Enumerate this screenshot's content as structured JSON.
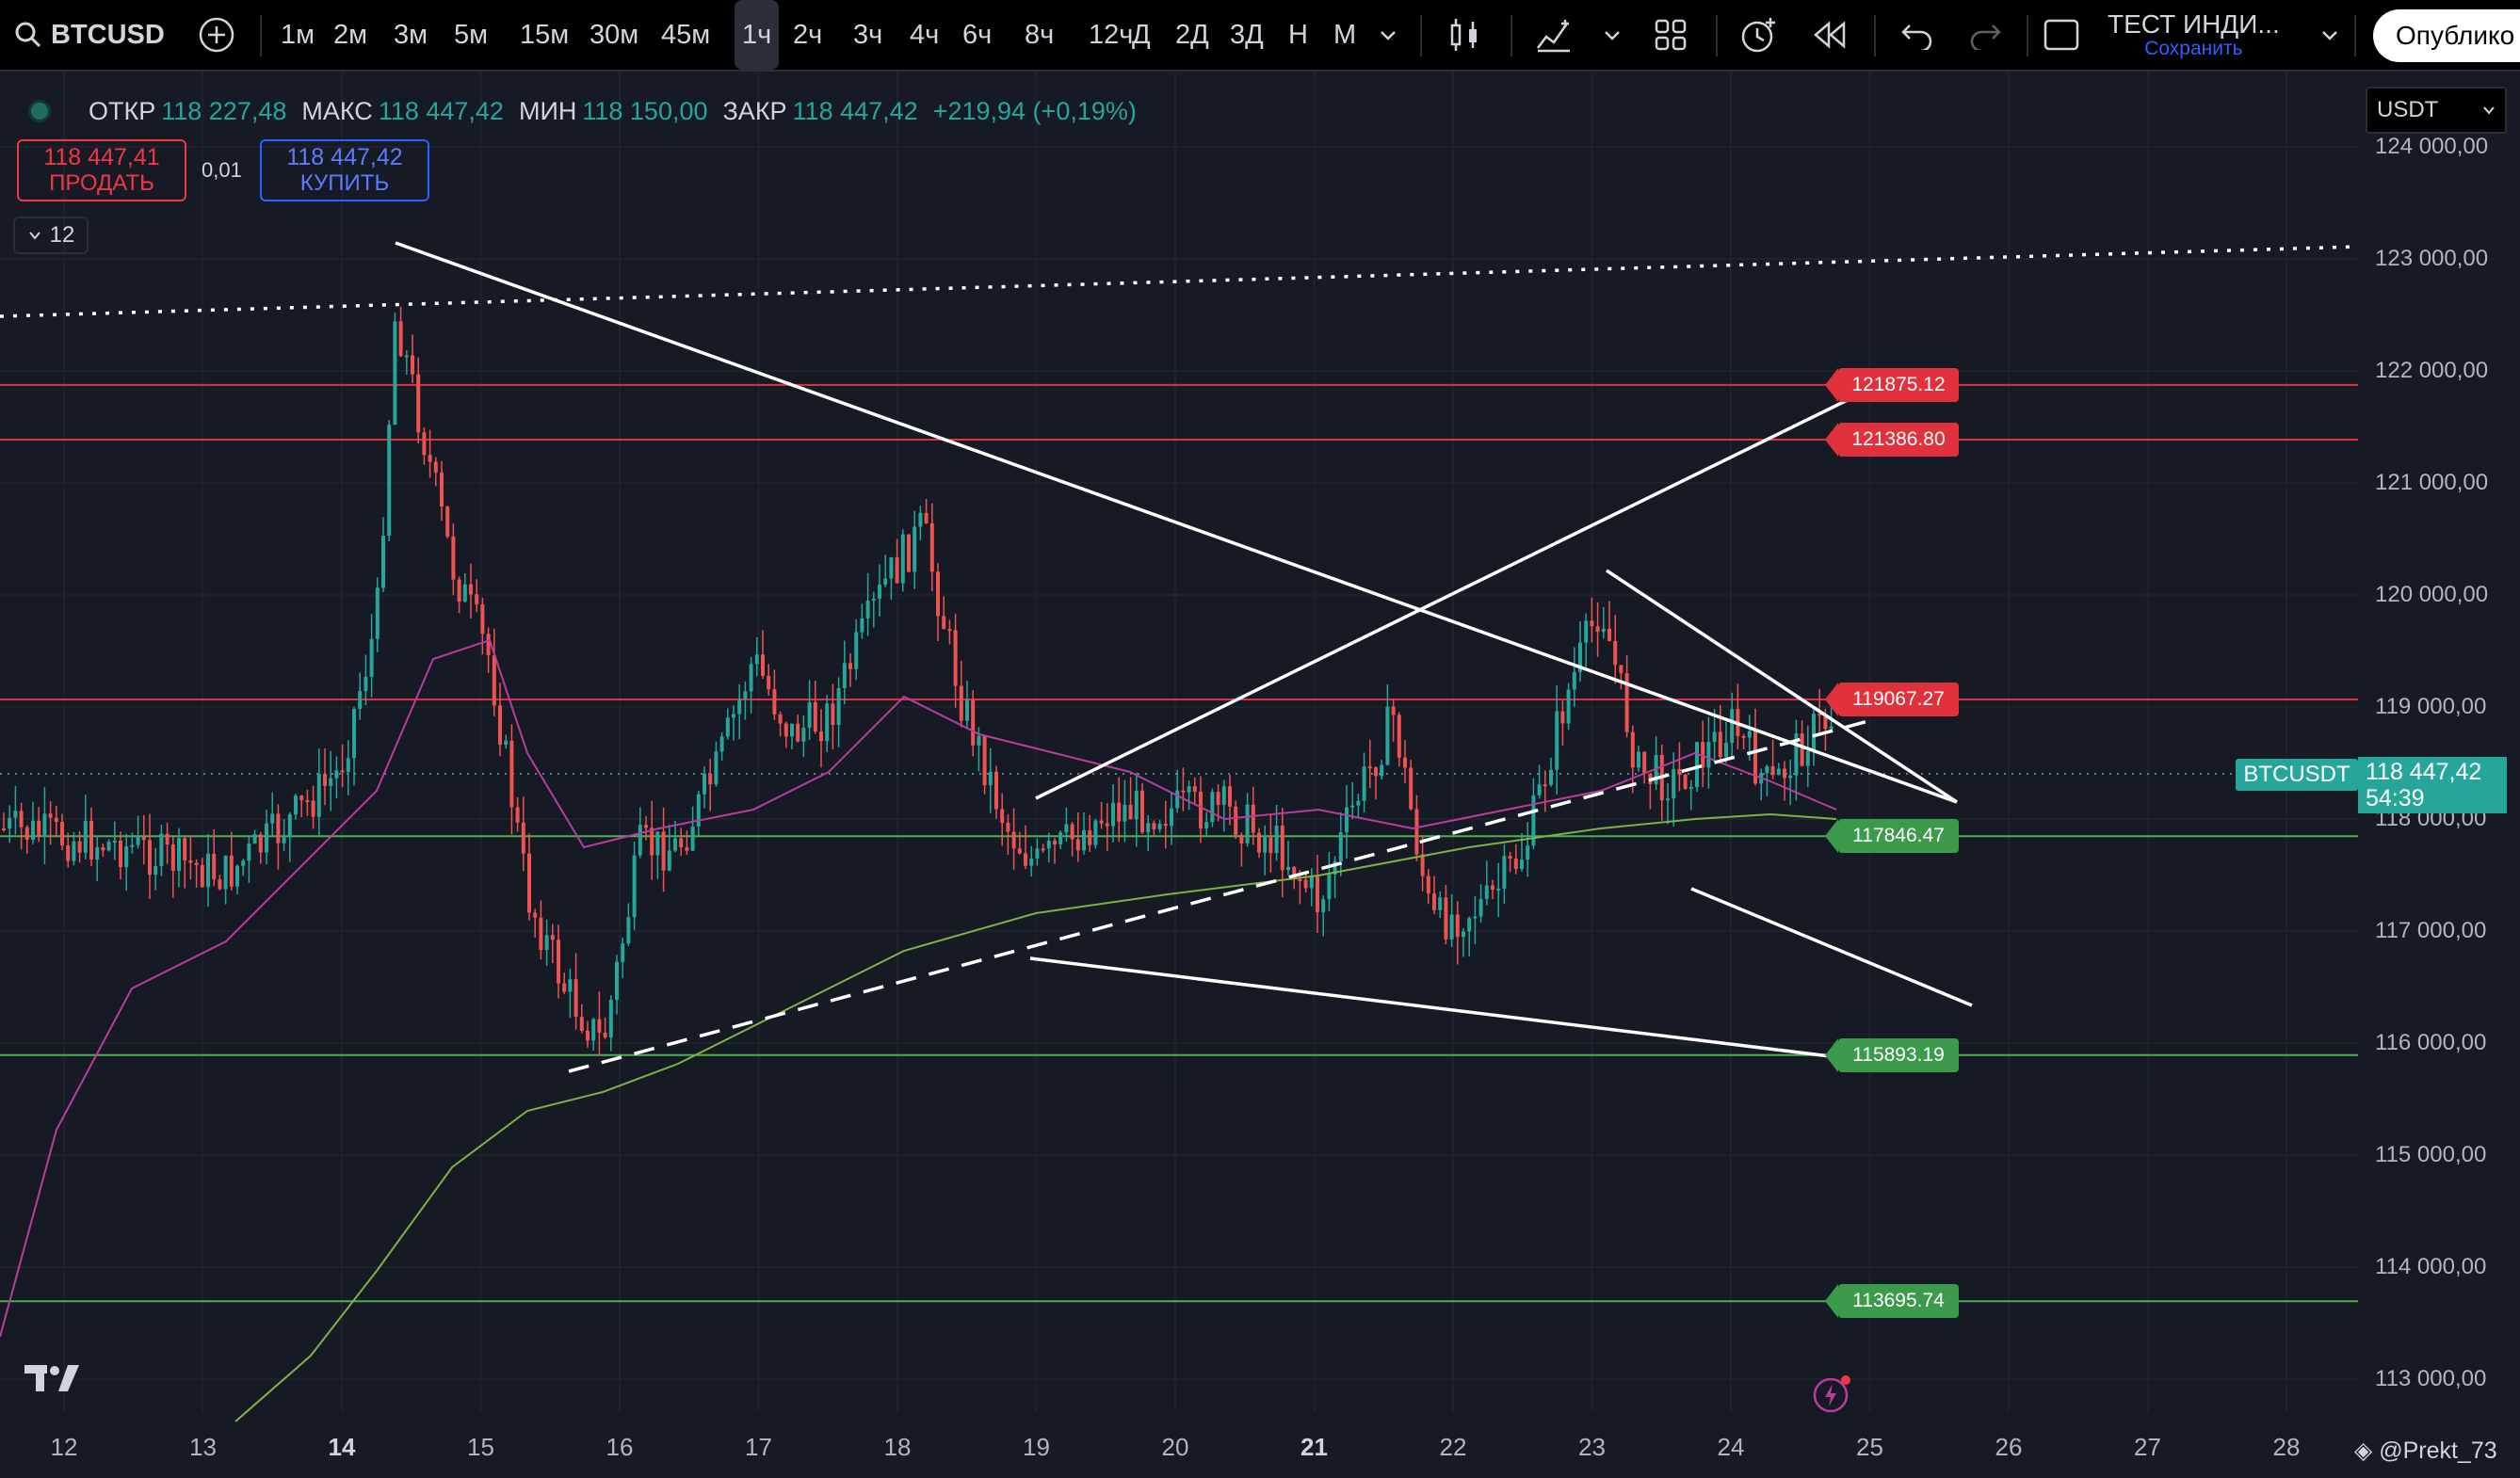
{
  "toolbar": {
    "symbol": "BTCUSD",
    "timeframes": [
      "1м",
      "2м",
      "3м",
      "5м",
      "15м",
      "30м",
      "45м",
      "1ч",
      "2ч",
      "3ч",
      "4ч",
      "6ч",
      "8ч",
      "12ч",
      "Д",
      "2Д",
      "3Д",
      "Н",
      "М"
    ],
    "active_timeframe": "1ч",
    "layout_name": "ТЕСТ ИНДИ...",
    "save_label": "Сохранить",
    "publish_label": "Опублико"
  },
  "legend": {
    "open_label": "ОТКР",
    "open": "118 227,48",
    "high_label": "МАКС",
    "high": "118 447,42",
    "low_label": "МИН",
    "low": "118 150,00",
    "close_label": "ЗАКР",
    "close": "118 447,42",
    "change": "+219,94 (+0,19%)"
  },
  "trade": {
    "sell_price": "118 447,41",
    "sell_label": "ПРОДАТЬ",
    "spread": "0,01",
    "buy_price": "118 447,42",
    "buy_label": "КУПИТЬ",
    "indicators_count": "12"
  },
  "currency": "USDT",
  "price_axis": [
    "124 000,00",
    "123 000,00",
    "122 000,00",
    "121 000,00",
    "120 000,00",
    "119 000,00",
    "118 000,00",
    "117 000,00",
    "116 000,00",
    "115 000,00",
    "114 000,00",
    "113 000,00"
  ],
  "time_axis": [
    "12",
    "13",
    "14",
    "15",
    "16",
    "17",
    "18",
    "19",
    "20",
    "21",
    "22",
    "23",
    "24",
    "25",
    "26",
    "27",
    "28"
  ],
  "time_axis_bold": [
    "14",
    "21"
  ],
  "levels": [
    {
      "price": 121875.12,
      "label": "121875.12",
      "kind": "resistance"
    },
    {
      "price": 121386.8,
      "label": "121386.80",
      "kind": "resistance"
    },
    {
      "price": 119067.27,
      "label": "119067.27",
      "kind": "resistance"
    },
    {
      "price": 117846.47,
      "label": "117846.47",
      "kind": "support"
    },
    {
      "price": 115893.19,
      "label": "115893.19",
      "kind": "support"
    },
    {
      "price": 113695.74,
      "label": "113695.74",
      "kind": "support"
    }
  ],
  "current": {
    "symbol": "BTCUSDT",
    "price": "118 447,42",
    "countdown": "54:39"
  },
  "watermark": "@Prekt_73",
  "colors": {
    "up": "#26a69a",
    "down": "#ef5350",
    "resistance": "#e0313d",
    "support": "#4caf50",
    "ma_fast": "#b83d9c",
    "ma_slow": "#7cb342"
  }
}
